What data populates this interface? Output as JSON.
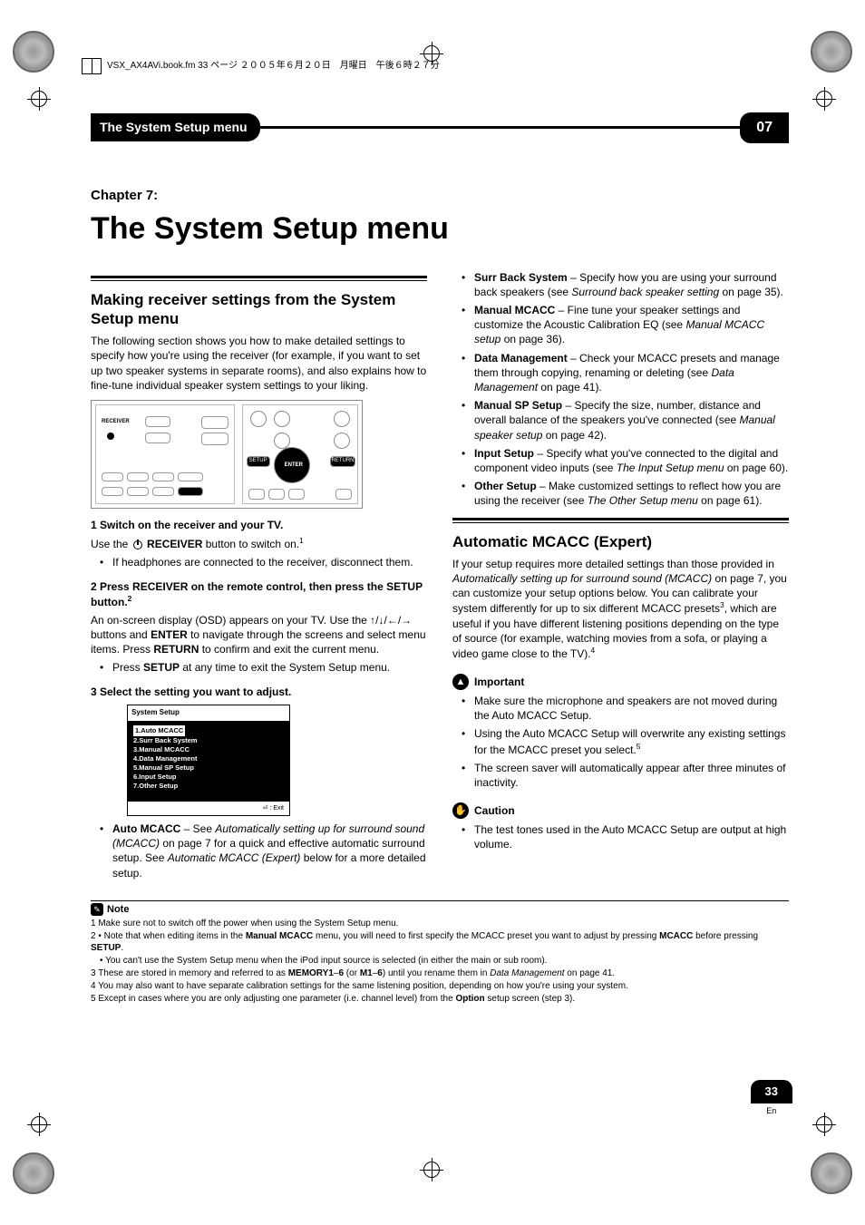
{
  "bookline": "VSX_AX4AVi.book.fm  33 ページ  ２００５年６月２０日　月曜日　午後６時２７分",
  "header": {
    "section": "The System Setup menu",
    "chapno": "07"
  },
  "chapter": {
    "label": "Chapter 7:",
    "title": "The System Setup menu"
  },
  "left": {
    "h2a": "Making receiver settings from the System Setup menu",
    "intro": "The following section shows you how to make detailed settings to specify how you're using the receiver (for example, if you want to set up two speaker systems in separate rooms), and also explains how to fine-tune individual speaker system settings to your liking.",
    "step1": "1    Switch on the receiver and your TV.",
    "step1_desc_a": "Use the ",
    "step1_desc_b": " RECEIVER",
    "step1_desc_c": " button to switch on.",
    "step1_sup": "1",
    "step1_bullet": "If headphones are connected to the receiver, disconnect them.",
    "step2": "2    Press RECEIVER on the remote control, then press the SETUP button.",
    "step2_sup": "2",
    "step2_desc_a": "An on-screen display (OSD) appears on your TV. Use the ",
    "step2_desc_b": " buttons and ",
    "step2_desc_c": "ENTER",
    "step2_desc_d": " to navigate through the screens and select menu items. Press ",
    "step2_desc_e": "RETURN",
    "step2_desc_f": " to confirm and exit the current menu.",
    "step2_bullet_a": "Press ",
    "step2_bullet_b": "SETUP",
    "step2_bullet_c": " at any time to exit the System Setup menu.",
    "step3": "3    Select the setting you want to adjust.",
    "osd": {
      "title": "System  Setup",
      "i1": "1.Auto  MCACC",
      "i2": "2.Surr  Back  System",
      "i3": "3.Manual  MCACC",
      "i4": "4.Data  Management",
      "i5": "5.Manual  SP  Setup",
      "i6": "6.Input  Setup",
      "i7": "7.Other  Setup",
      "foot": "⏎ : Exit"
    },
    "auto_b": "Auto MCACC",
    "auto_a": " – See ",
    "auto_i1": "Automatically setting up for surround sound (MCACC)",
    "auto_c": " on page 7 for a quick and effective automatic surround setup. See ",
    "auto_i2": "Automatic MCACC (Expert)",
    "auto_d": " below for a more detailed setup."
  },
  "right": {
    "surr_b": "Surr Back System",
    "surr_a": " – Specify how you are using your surround back speakers (see ",
    "surr_i": "Surround back speaker setting",
    "surr_c": " on page 35).",
    "man_b": "Manual MCACC",
    "man_a": " – Fine tune your speaker settings and customize the Acoustic Calibration EQ (see ",
    "man_i": "Manual MCACC setup",
    "man_c": " on page 36).",
    "data_b": "Data Management",
    "data_a": " – Check your MCACC presets and manage them through copying, renaming or deleting (see ",
    "data_i": "Data Management",
    "data_c": " on page 41).",
    "sp_b": "Manual SP Setup",
    "sp_a": " – Specify the size, number, distance and overall balance of the speakers you've connected (see ",
    "sp_i": "Manual speaker setup",
    "sp_c": " on page 42).",
    "inp_b": "Input Setup",
    "inp_a": " – Specify what you've connected to the digital and component video inputs (see ",
    "inp_i": "The Input Setup menu",
    "inp_c": " on page 60).",
    "oth_b": "Other Setup",
    "oth_a": " – Make customized settings to reflect how you are using the receiver (see ",
    "oth_i": "The Other Setup menu",
    "oth_c": " on page 61).",
    "h2b": "Automatic MCACC (Expert)",
    "exp_a": "If your setup requires more detailed settings than those provided in ",
    "exp_i": "Automatically setting up for surround sound (MCACC)",
    "exp_b": " on page 7, you can customize your setup options below. You can calibrate your system differently for up to six different MCACC presets",
    "exp_sup3": "3",
    "exp_c": ", which are useful if you have different listening positions depending on the type of source (for example, watching movies from a sofa, or playing a video game close to the TV).",
    "exp_sup4": "4",
    "important_label": "Important",
    "imp1": "Make sure the microphone and speakers are not moved during the Auto MCACC Setup.",
    "imp2_a": "Using the Auto MCACC Setup will overwrite any existing settings for the MCACC preset you select.",
    "imp2_sup": "5",
    "imp3": "The screen saver will automatically appear after three minutes of inactivity.",
    "caution_label": "Caution",
    "caution1": "The test tones used in the Auto MCACC Setup are output at high volume."
  },
  "notes": {
    "title": "Note",
    "n1": "1 Make sure not to switch off the power when using the System Setup menu.",
    "n2a": "2 • Note that when editing items in the ",
    "n2b": "Manual MCACC",
    "n2c": " menu, you will need to first specify the MCACC preset you want to adjust by pressing ",
    "n2d": "MCACC",
    "n2e": " before pressing ",
    "n2f": "SETUP",
    "n2g": ".",
    "n2h": "• You can't use the System Setup menu when the iPod input source is selected (in either the main or sub room).",
    "n3a": "3 These are stored in memory and referred to as ",
    "n3b": "MEMORY1",
    "n3c": "–",
    "n3d": "6",
    "n3e": " (or ",
    "n3f": "M1",
    "n3g": "–",
    "n3h": "6",
    "n3i": ") until you rename them in ",
    "n3j": "Data Management",
    "n3k": " on page 41.",
    "n4": "4 You may also want to have separate calibration settings for the same listening position, depending on how you're using your system.",
    "n5a": "5 Except in cases where you are only adjusting one parameter (i.e. channel level) from the ",
    "n5b": "Option",
    "n5c": " setup screen (step 3)."
  },
  "page_badge": {
    "num": "33",
    "lang": "En"
  },
  "remote": {
    "label_receiver": "RECEIVER",
    "label_setup": "SETUP",
    "label_enter": "ENTER",
    "label_return": "RETURN"
  }
}
